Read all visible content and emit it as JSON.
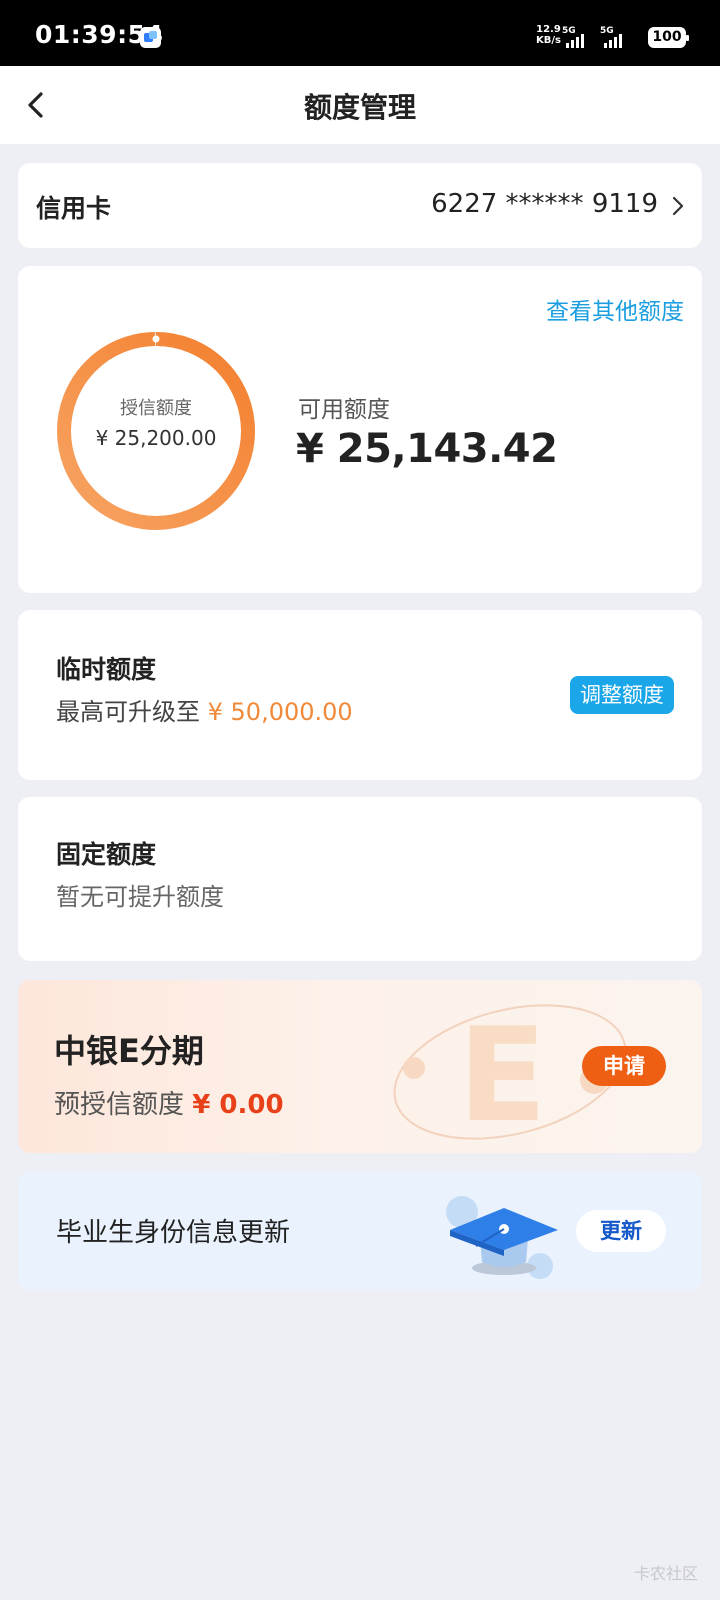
{
  "status_bar": {
    "time": "01:39:54",
    "net_speed_value": "12.9",
    "net_speed_unit": "KB/s",
    "signal1_label": "5G",
    "signal2_label": "5G",
    "battery": "100"
  },
  "nav": {
    "title": "额度管理"
  },
  "card": {
    "label": "信用卡",
    "number": "6227 ****** 9119"
  },
  "limit": {
    "other_link": "查看其他额度",
    "credit_label": "授信额度",
    "credit_value": "¥ 25,200.00",
    "available_label": "可用额度",
    "available_value": "¥ 25,143.42",
    "ring_color": "#f7893a",
    "available_ratio": 0.9978
  },
  "temporary": {
    "title": "临时额度",
    "desc_prefix": "最高可升级至",
    "desc_amount": "¥ 50,000.00",
    "button": "调整额度"
  },
  "fixed": {
    "title": "固定额度",
    "desc": "暂无可提升额度"
  },
  "installment": {
    "title": "中银E分期",
    "desc_prefix": "预授信额度",
    "amount": "¥ 0.00",
    "button": "申请"
  },
  "graduate": {
    "text": "毕业生身份信息更新",
    "button": "更新"
  },
  "watermark": "卡农社区",
  "colors": {
    "accent_blue": "#1aa6e8",
    "accent_orange": "#f08a3a",
    "red": "#e8411a"
  }
}
